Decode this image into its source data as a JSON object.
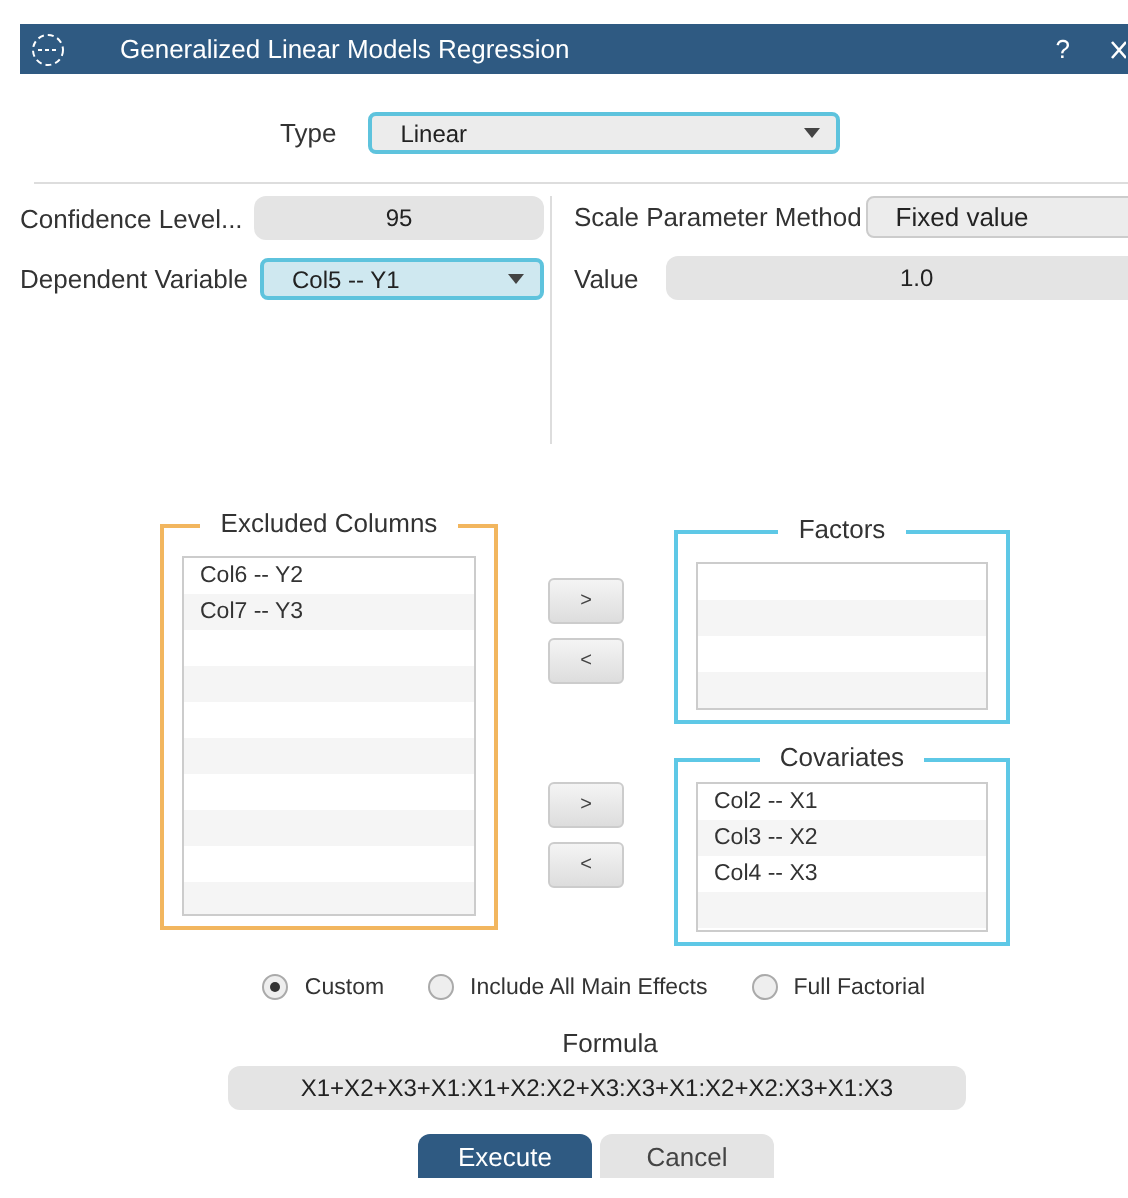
{
  "window": {
    "title": "Generalized Linear Models Regression",
    "help": "?"
  },
  "type": {
    "label": "Type",
    "value": "Linear"
  },
  "confidence": {
    "label": "Confidence Level...",
    "value": "95"
  },
  "dependent": {
    "label": "Dependent Variable",
    "value": "Col5 -- Y1"
  },
  "scale_method": {
    "label": "Scale Parameter Method",
    "value": "Fixed value"
  },
  "scale_value": {
    "label": "Value",
    "value": "1.0"
  },
  "excluded": {
    "title": "Excluded Columns",
    "items": [
      "Col6 -- Y2",
      "Col7 -- Y3"
    ]
  },
  "factors": {
    "title": "Factors"
  },
  "covariates": {
    "title": "Covariates",
    "items": [
      "Col2 -- X1",
      "Col3 -- X2",
      "Col4 -- X3"
    ]
  },
  "move_buttons": [
    ">",
    "<",
    ">",
    "<"
  ],
  "model_options": [
    {
      "label": "Custom",
      "selected": true
    },
    {
      "label": "Include All Main Effects",
      "selected": false
    },
    {
      "label": "Full Factorial",
      "selected": false
    }
  ],
  "formula": {
    "label": "Formula",
    "value": "X1+X2+X3+X1:X1+X2:X2+X3:X3+X1:X2+X2:X3+X1:X3"
  },
  "buttons": [
    {
      "label": "Execute",
      "kind": "primary"
    },
    {
      "label": "Cancel",
      "kind": "secondary"
    }
  ]
}
